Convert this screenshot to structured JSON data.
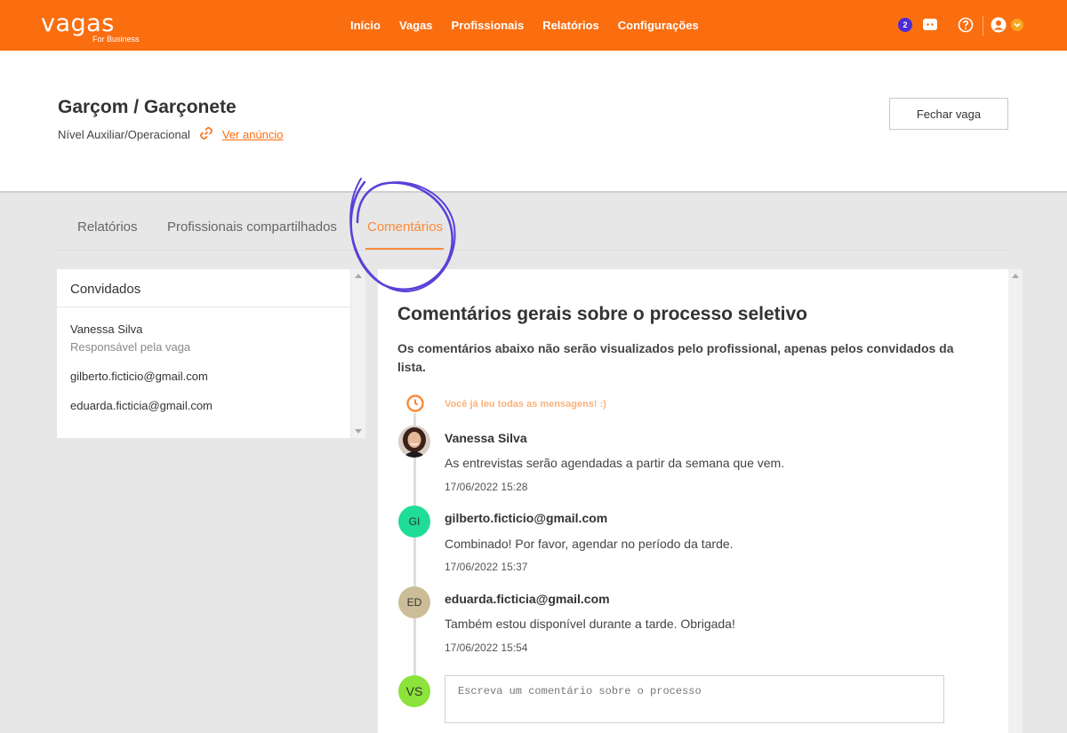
{
  "brand": {
    "logo_word": "vagas",
    "logo_sub": "For Business",
    "primary_color": "#fa6e10"
  },
  "nav": {
    "items": [
      {
        "label": "Início"
      },
      {
        "label": "Vagas"
      },
      {
        "label": "Profissionais"
      },
      {
        "label": "Relatórios"
      },
      {
        "label": "Configurações"
      }
    ],
    "notification_count": "2",
    "icons": [
      "chat-icon",
      "help-icon",
      "user-icon",
      "chevron-down-icon"
    ]
  },
  "job": {
    "title": "Garçom / Garçonete",
    "level": "Nível Auxiliar/Operacional",
    "link_label": "Ver anúncio",
    "close_button": "Fechar vaga"
  },
  "tabs": [
    {
      "label": "Relatórios",
      "active": false
    },
    {
      "label": "Profissionais compartilhados",
      "active": false
    },
    {
      "label": "Comentários",
      "active": true
    }
  ],
  "guests": {
    "title": "Convidados",
    "list": [
      {
        "name": "Vanessa Silva",
        "role": "Responsável pela vaga"
      },
      {
        "name": "gilberto.ficticio@gmail.com"
      },
      {
        "name": "eduarda.ficticia@gmail.com"
      }
    ]
  },
  "comments": {
    "title": "Comentários gerais sobre o processo seletivo",
    "note": "Os comentários abaixo não serão visualizados pelo profissional, apenas pelos convidados da lista.",
    "read_message": "Você já leu todas as mensagens! :)",
    "items": [
      {
        "author": "Vanessa Silva",
        "initials": "",
        "avatar_color": "#5a3b2e",
        "text": "As entrevistas serão agendadas a partir da semana que vem.",
        "date": "17/06/2022 15:28"
      },
      {
        "author": "gilberto.ficticio@gmail.com",
        "initials": "GI",
        "avatar_color": "#1fdc97",
        "text": "Combinado! Por favor, agendar no período da tarde.",
        "date": "17/06/2022 15:37"
      },
      {
        "author": "eduarda.ficticia@gmail.com",
        "initials": "ED",
        "avatar_color": "#cbbd97",
        "text": "Também estou disponível durante a tarde. Obrigada!",
        "date": "17/06/2022 15:54"
      }
    ],
    "composer": {
      "initials": "VS",
      "avatar_color": "#8be33b",
      "placeholder": "Escreva um comentário sobre o processo"
    }
  }
}
